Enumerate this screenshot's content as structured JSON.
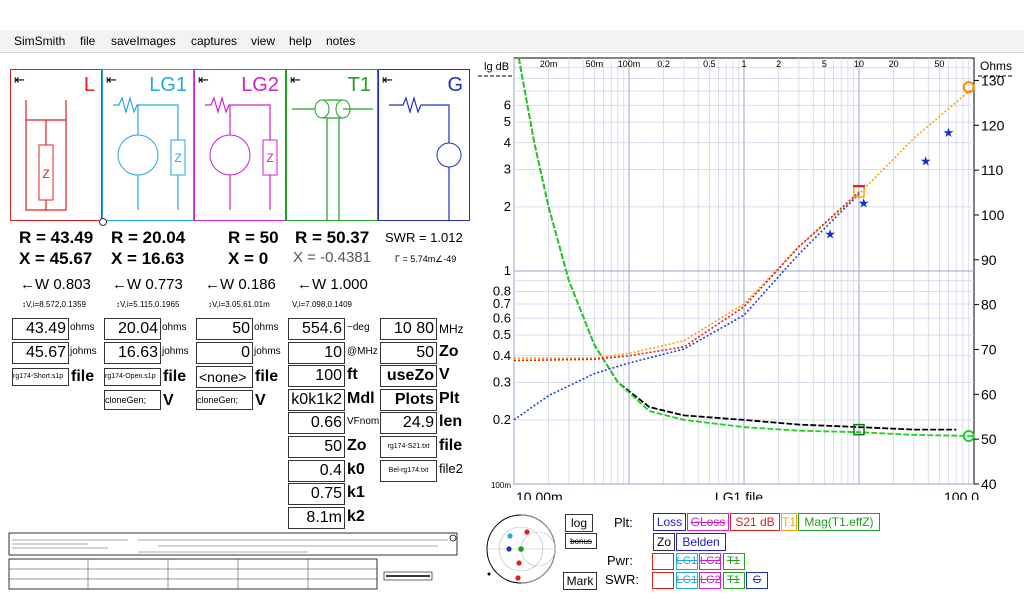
{
  "menu": [
    "SimSmith",
    "file",
    "saveImages",
    "captures",
    "view",
    "help",
    "notes"
  ],
  "panels": [
    {
      "label": "L",
      "color": "#e02020",
      "r": "R = 43.49",
      "x": "X = 45.67",
      "w": "←W 0.803",
      "vi": "↕V,i=8.572,0.1359",
      "val1": "43.49",
      "u1": "ohms",
      "val2": "45.67",
      "u2": "johms",
      "fname": "rg174-Short.s1p",
      "fword": "file"
    },
    {
      "label": "LG1",
      "color": "#22aadd",
      "r": "R = 20.04",
      "x": "X = 16.63",
      "w": "←W 0.773",
      "vi": "↕V,i=5.115,0.1965",
      "val1": "20.04",
      "u1": "ohms",
      "val2": "16.63",
      "u2": "johms",
      "fname": "rg174-Open.s1p",
      "fword": "file",
      "clone": "cloneGen;",
      "cloneV": "V"
    },
    {
      "label": "LG2",
      "color": "#d020c8",
      "r": "R = 50",
      "x": "X = 0",
      "w": "←W 0.186",
      "vi": "↕V,i=3.05,61.01m",
      "val1": "50",
      "u1": "ohms",
      "val2": "0",
      "u2": "johms",
      "fname": "<none>",
      "fword": "file",
      "clone": "cloneGen;",
      "cloneV": "V"
    },
    {
      "label": "T1",
      "color": "#20a020",
      "r": "R = 50.37",
      "x": "X = -0.4381",
      "w": "←W 1.000",
      "vi": "V,i=7.098,0.1409"
    },
    {
      "label": "G",
      "color": "#2030c0",
      "swr": "SWR = 1.012",
      "gamma": "Γ = 5.74m∠-49"
    }
  ],
  "t1": {
    "rows": [
      {
        "v": "554.6",
        "u": "~deg",
        "small": true
      },
      {
        "v": "10",
        "u": "@MHz",
        "small": true
      },
      {
        "v": "100",
        "u": "ft",
        "small": false
      },
      {
        "v": "k0k1k2",
        "u": "Mdl",
        "small": false
      },
      {
        "v": "0.66",
        "u": "VFnom",
        "small": true
      },
      {
        "v": "50",
        "u": "Zo",
        "small": false
      },
      {
        "v": "0.4",
        "u": "k0",
        "small": false
      },
      {
        "v": "0.75",
        "u": "k1",
        "small": false
      },
      {
        "v": "8.1m",
        "u": "k2",
        "small": false
      }
    ]
  },
  "g": {
    "rows": [
      {
        "v": "10 80",
        "u": "MHz"
      },
      {
        "v": "50",
        "u": "Zo"
      },
      {
        "v": "useZo",
        "u": "V"
      },
      {
        "v": "Plots",
        "u": "Plt"
      },
      {
        "v": "24.9",
        "u": "len"
      },
      {
        "v": "rg174-S21.txt",
        "u": "file"
      },
      {
        "v": "Bel-rg174.txt",
        "u": "file2"
      }
    ]
  },
  "chart_data": {
    "type": "line",
    "title": "",
    "xlabel": "LG1.file",
    "x_scale": "log",
    "xlim": [
      0.01,
      100
    ],
    "x_ticks_bottom": [
      "10.00m",
      "100.0"
    ],
    "x_ticks_top": [
      "20m",
      "50m",
      "100m",
      "0.2",
      "0.5",
      "1",
      "2",
      "5",
      "10",
      "20",
      "50"
    ],
    "y_left_label": "lg dB",
    "y_left_scale": "log",
    "ylim_left": [
      0.1,
      10
    ],
    "y_left_ticks": [
      "100m",
      "0.2",
      "0.3",
      "0.4",
      "0.5",
      "0.6",
      "0.7",
      "0.8",
      "1",
      "2",
      "3",
      "4",
      "5",
      "6"
    ],
    "y_right_label": "Ohms",
    "ylim_right": [
      40,
      135
    ],
    "y_right_ticks": [
      "40",
      "50",
      "60",
      "70",
      "80",
      "90",
      "100",
      "110",
      "120",
      "130"
    ],
    "grid": true,
    "series": [
      {
        "color": "#000000",
        "style": "dashed",
        "points": [
          [
            0.011,
            10
          ],
          [
            0.015,
            4
          ],
          [
            0.02,
            2
          ],
          [
            0.03,
            0.9
          ],
          [
            0.05,
            0.45
          ],
          [
            0.08,
            0.3
          ],
          [
            0.15,
            0.23
          ],
          [
            0.3,
            0.21
          ],
          [
            1,
            0.2
          ],
          [
            3,
            0.19
          ],
          [
            10,
            0.185
          ],
          [
            30,
            0.18
          ],
          [
            70,
            0.18
          ]
        ]
      },
      {
        "color": "#20d020",
        "style": "dashed",
        "points": [
          [
            0.011,
            10
          ],
          [
            0.015,
            4
          ],
          [
            0.02,
            2
          ],
          [
            0.03,
            0.9
          ],
          [
            0.05,
            0.45
          ],
          [
            0.08,
            0.3
          ],
          [
            0.15,
            0.22
          ],
          [
            0.3,
            0.2
          ],
          [
            1,
            0.185
          ],
          [
            3,
            0.178
          ],
          [
            10,
            0.175
          ],
          [
            30,
            0.17
          ],
          [
            100,
            0.168
          ]
        ]
      },
      {
        "color": "#ffa000",
        "style": "dotted",
        "points": [
          [
            0.01,
            0.39
          ],
          [
            0.05,
            0.39
          ],
          [
            0.1,
            0.41
          ],
          [
            0.3,
            0.47
          ],
          [
            1,
            0.7
          ],
          [
            3,
            1.3
          ],
          [
            10,
            2.3
          ],
          [
            30,
            4.2
          ],
          [
            100,
            7.3
          ]
        ]
      },
      {
        "color": "#e02020",
        "style": "dotted",
        "points": [
          [
            0.01,
            0.38
          ],
          [
            0.05,
            0.385
          ],
          [
            0.1,
            0.4
          ],
          [
            0.3,
            0.44
          ],
          [
            1,
            0.68
          ],
          [
            3,
            1.3
          ],
          [
            10,
            2.35
          ]
        ]
      },
      {
        "color": "#2040e0",
        "style": "dotted",
        "points": [
          [
            0.01,
            0.2
          ],
          [
            0.02,
            0.26
          ],
          [
            0.05,
            0.33
          ],
          [
            0.1,
            0.37
          ],
          [
            0.3,
            0.43
          ],
          [
            1,
            0.62
          ],
          [
            3,
            1.2
          ],
          [
            10,
            2.3
          ]
        ]
      }
    ],
    "stars": [
      [
        5.6,
        1.5
      ],
      [
        11,
        2.1
      ],
      [
        38,
        3.3
      ],
      [
        60,
        4.5
      ]
    ]
  },
  "legend": {
    "plt_label": "Plt:",
    "items": [
      {
        "t": "Loss",
        "c": "#2020c0"
      },
      {
        "t": "GLoss",
        "c": "#d020c8"
      },
      {
        "t": "S21 dB",
        "c": "#e02020"
      },
      {
        "t": "T1",
        "c": "#ffa000"
      },
      {
        "t": "Mag(T1.effZ)",
        "c": "#20a020"
      }
    ],
    "row2": [
      {
        "t": "Zo",
        "c": "#000"
      },
      {
        "t": "Belden",
        "c": "#2020c0"
      }
    ],
    "pwr": "Pwr:",
    "swr": "SWR:",
    "log": "log",
    "bonus": "bonus",
    "mark": "Mark"
  }
}
